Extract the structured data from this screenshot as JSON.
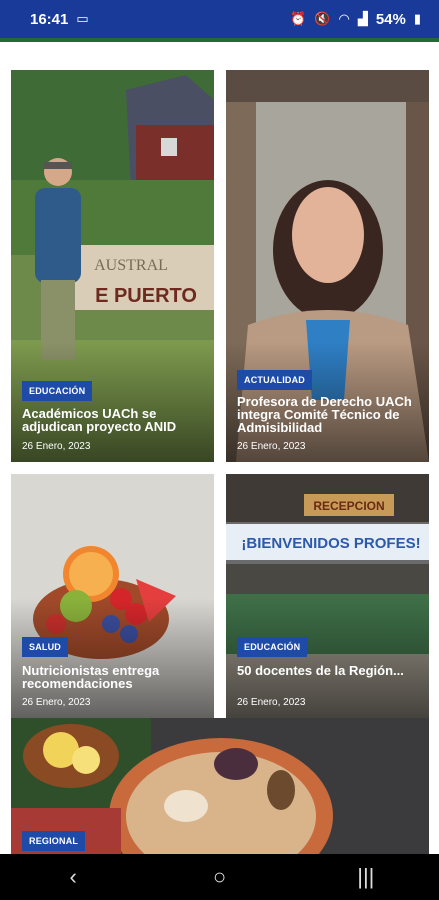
{
  "status": {
    "time": "16:41",
    "battery": "54%"
  },
  "articles": [
    {
      "category": "EDUCACIÓN",
      "title": "Académicos UACh se adjudican proyecto ANID",
      "date": "26 Enero, 2023"
    },
    {
      "category": "ACTUALIDAD",
      "title": "Profesora de Derecho UACh integra Comité Técnico de Admisibilidad",
      "date": "26 Enero, 2023"
    },
    {
      "category": "SALUD",
      "title": "Nutricionistas entrega recomendaciones",
      "date": "26 Enero, 2023"
    },
    {
      "category": "EDUCACIÓN",
      "title": "50 docentes de la Región...",
      "date": "26 Enero, 2023"
    },
    {
      "category": "REGIONAL",
      "title": "",
      "date": ""
    }
  ],
  "photo_text": {
    "sign_top": "AUSTRAL",
    "sign_bottom": "E PUERTO",
    "reception": "RECEPCION",
    "banner": "¡BIENVENIDOS PROFES!"
  },
  "colors": {
    "status_bar": "#1a3a9a",
    "badge": "#1f4ba8",
    "accent_green": "#1f6b3c"
  }
}
